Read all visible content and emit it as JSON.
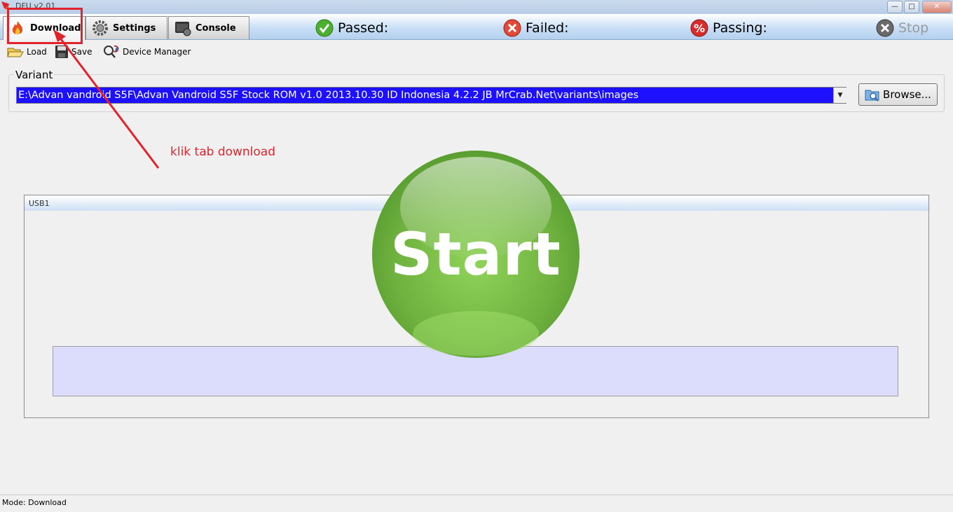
{
  "window": {
    "title": "DFU v2.01"
  },
  "tabs": [
    {
      "label": "Download",
      "icon": "flame-icon"
    },
    {
      "label": "Settings",
      "icon": "gear-icon"
    },
    {
      "label": "Console",
      "icon": "console-icon"
    }
  ],
  "status": {
    "passed": "Passed:",
    "failed": "Failed:",
    "passing": "Passing:",
    "stop": "Stop"
  },
  "toolbar": {
    "load": "Load",
    "save": "Save",
    "device_manager": "Device Manager"
  },
  "variant": {
    "label": "Variant",
    "value": "E:\\Advan vandroid S5F\\Advan Vandroid S5F Stock ROM v1.0 2013.10.30 ID Indonesia 4.2.2 JB MrCrab.Net\\variants\\images",
    "browse": "Browse..."
  },
  "usb_panel": {
    "label": "USB1"
  },
  "start_button": {
    "label": "Start"
  },
  "annotation": {
    "text": "klik tab download",
    "color": "#e3232b"
  },
  "statusbar": {
    "text": "Mode: Download"
  },
  "colors": {
    "variant_bg": "#1c10ff",
    "progress_bg": "#dcdcfd",
    "start_green": "#7cc04a",
    "annotation_red": "#e3232b"
  }
}
